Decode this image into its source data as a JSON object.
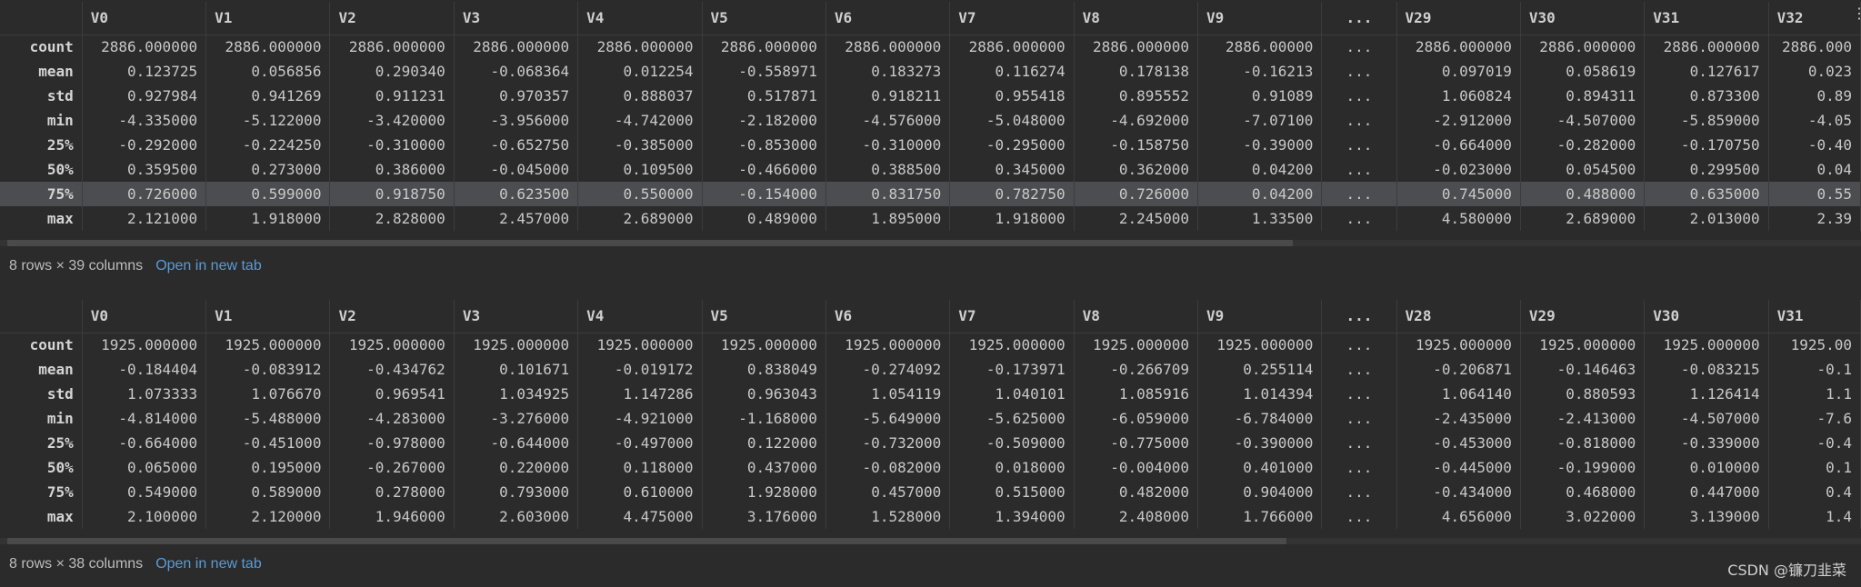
{
  "tables": [
    {
      "columns": [
        "V0",
        "V1",
        "V2",
        "V3",
        "V4",
        "V5",
        "V6",
        "V7",
        "V8",
        "V9",
        "...",
        "V29",
        "V30",
        "V31",
        "V32"
      ],
      "rows": [
        {
          "label": "count",
          "values": [
            "2886.000000",
            "2886.000000",
            "2886.000000",
            "2886.000000",
            "2886.000000",
            "2886.000000",
            "2886.000000",
            "2886.000000",
            "2886.000000",
            "2886.00000",
            "...",
            "2886.000000",
            "2886.000000",
            "2886.000000",
            "2886.000"
          ]
        },
        {
          "label": "mean",
          "values": [
            "0.123725",
            "0.056856",
            "0.290340",
            "-0.068364",
            "0.012254",
            "-0.558971",
            "0.183273",
            "0.116274",
            "0.178138",
            "-0.16213",
            "...",
            "0.097019",
            "0.058619",
            "0.127617",
            "0.023"
          ]
        },
        {
          "label": "std",
          "values": [
            "0.927984",
            "0.941269",
            "0.911231",
            "0.970357",
            "0.888037",
            "0.517871",
            "0.918211",
            "0.955418",
            "0.895552",
            "0.91089",
            "...",
            "1.060824",
            "0.894311",
            "0.873300",
            "0.89"
          ]
        },
        {
          "label": "min",
          "values": [
            "-4.335000",
            "-5.122000",
            "-3.420000",
            "-3.956000",
            "-4.742000",
            "-2.182000",
            "-4.576000",
            "-5.048000",
            "-4.692000",
            "-7.07100",
            "...",
            "-2.912000",
            "-4.507000",
            "-5.859000",
            "-4.05"
          ]
        },
        {
          "label": "25%",
          "values": [
            "-0.292000",
            "-0.224250",
            "-0.310000",
            "-0.652750",
            "-0.385000",
            "-0.853000",
            "-0.310000",
            "-0.295000",
            "-0.158750",
            "-0.39000",
            "...",
            "-0.664000",
            "-0.282000",
            "-0.170750",
            "-0.40"
          ]
        },
        {
          "label": "50%",
          "values": [
            "0.359500",
            "0.273000",
            "0.386000",
            "-0.045000",
            "0.109500",
            "-0.466000",
            "0.388500",
            "0.345000",
            "0.362000",
            "0.04200",
            "...",
            "-0.023000",
            "0.054500",
            "0.299500",
            "0.04"
          ]
        },
        {
          "label": "75%",
          "values": [
            "0.726000",
            "0.599000",
            "0.918750",
            "0.623500",
            "0.550000",
            "-0.154000",
            "0.831750",
            "0.782750",
            "0.726000",
            "0.04200",
            "...",
            "0.745000",
            "0.488000",
            "0.635000",
            "0.55"
          ]
        },
        {
          "label": "max",
          "values": [
            "2.121000",
            "1.918000",
            "2.828000",
            "2.457000",
            "2.689000",
            "0.489000",
            "1.895000",
            "1.918000",
            "2.245000",
            "1.33500",
            "...",
            "4.580000",
            "2.689000",
            "2.013000",
            "2.39"
          ]
        }
      ],
      "highlighted_row": "75%",
      "footer": {
        "shape": "8 rows × 39 columns",
        "link": "Open in new tab"
      }
    },
    {
      "columns": [
        "V0",
        "V1",
        "V2",
        "V3",
        "V4",
        "V5",
        "V6",
        "V7",
        "V8",
        "V9",
        "...",
        "V28",
        "V29",
        "V30",
        "V31"
      ],
      "rows": [
        {
          "label": "count",
          "values": [
            "1925.000000",
            "1925.000000",
            "1925.000000",
            "1925.000000",
            "1925.000000",
            "1925.000000",
            "1925.000000",
            "1925.000000",
            "1925.000000",
            "1925.000000",
            "...",
            "1925.000000",
            "1925.000000",
            "1925.000000",
            "1925.00"
          ]
        },
        {
          "label": "mean",
          "values": [
            "-0.184404",
            "-0.083912",
            "-0.434762",
            "0.101671",
            "-0.019172",
            "0.838049",
            "-0.274092",
            "-0.173971",
            "-0.266709",
            "0.255114",
            "...",
            "-0.206871",
            "-0.146463",
            "-0.083215",
            "-0.1"
          ]
        },
        {
          "label": "std",
          "values": [
            "1.073333",
            "1.076670",
            "0.969541",
            "1.034925",
            "1.147286",
            "0.963043",
            "1.054119",
            "1.040101",
            "1.085916",
            "1.014394",
            "...",
            "1.064140",
            "0.880593",
            "1.126414",
            "1.1"
          ]
        },
        {
          "label": "min",
          "values": [
            "-4.814000",
            "-5.488000",
            "-4.283000",
            "-3.276000",
            "-4.921000",
            "-1.168000",
            "-5.649000",
            "-5.625000",
            "-6.059000",
            "-6.784000",
            "...",
            "-2.435000",
            "-2.413000",
            "-4.507000",
            "-7.6"
          ]
        },
        {
          "label": "25%",
          "values": [
            "-0.664000",
            "-0.451000",
            "-0.978000",
            "-0.644000",
            "-0.497000",
            "0.122000",
            "-0.732000",
            "-0.509000",
            "-0.775000",
            "-0.390000",
            "...",
            "-0.453000",
            "-0.818000",
            "-0.339000",
            "-0.4"
          ]
        },
        {
          "label": "50%",
          "values": [
            "0.065000",
            "0.195000",
            "-0.267000",
            "0.220000",
            "0.118000",
            "0.437000",
            "-0.082000",
            "0.018000",
            "-0.004000",
            "0.401000",
            "...",
            "-0.445000",
            "-0.199000",
            "0.010000",
            "0.1"
          ]
        },
        {
          "label": "75%",
          "values": [
            "0.549000",
            "0.589000",
            "0.278000",
            "0.793000",
            "0.610000",
            "1.928000",
            "0.457000",
            "0.515000",
            "0.482000",
            "0.904000",
            "...",
            "-0.434000",
            "0.468000",
            "0.447000",
            "0.4"
          ]
        },
        {
          "label": "max",
          "values": [
            "2.100000",
            "2.120000",
            "1.946000",
            "2.603000",
            "4.475000",
            "3.176000",
            "1.528000",
            "1.394000",
            "2.408000",
            "1.766000",
            "...",
            "4.656000",
            "3.022000",
            "3.139000",
            "1.4"
          ]
        }
      ],
      "highlighted_row": "",
      "footer": {
        "shape": "8 rows × 38 columns",
        "link": "Open in new tab"
      }
    }
  ],
  "watermark": "CSDN @镰刀韭菜",
  "icons": {
    "more": "more-vertical-icon"
  }
}
